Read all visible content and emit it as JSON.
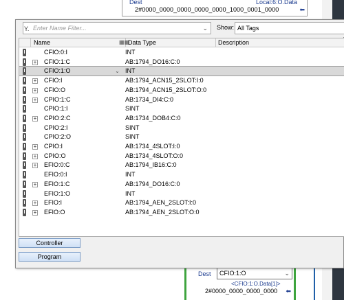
{
  "background": {
    "top_instruction": {
      "dest_label": "Dest",
      "dest_value": "Local:6:O.Data",
      "binary_value": "2#0000_0000_0000_0000_0000_1000_0001_0000"
    },
    "bottom_instruction": {
      "dest_label": "Dest",
      "dest_select_value": "CFIO:1:O",
      "tag_text": "<CFIO:1:O.Data[1]>",
      "binary_value": "2#0000_0000_0000_0000"
    }
  },
  "filter": {
    "placeholder": "Enter Name Filter...",
    "show_label": "Show:",
    "show_value": "All Tags"
  },
  "columns": [
    "Name",
    "Data Type",
    "Description"
  ],
  "rows": [
    {
      "name": "CFIO:0:I",
      "type": "INT",
      "expandable": false,
      "selected": false
    },
    {
      "name": "CFIO:1:C",
      "type": "AB:1794_DO16:C:0",
      "expandable": true,
      "selected": false
    },
    {
      "name": "CFIO:1:O",
      "type": "INT",
      "expandable": false,
      "selected": true
    },
    {
      "name": "CFIO:I",
      "type": "AB:1794_ACN15_2SLOT:I:0",
      "expandable": true,
      "selected": false
    },
    {
      "name": "CFIO:O",
      "type": "AB:1794_ACN15_2SLOT:O:0",
      "expandable": true,
      "selected": false
    },
    {
      "name": "CPIO:1:C",
      "type": "AB:1734_DI4:C:0",
      "expandable": true,
      "selected": false
    },
    {
      "name": "CPIO:1:I",
      "type": "SINT",
      "expandable": false,
      "selected": false
    },
    {
      "name": "CPIO:2:C",
      "type": "AB:1734_DOB4:C:0",
      "expandable": true,
      "selected": false
    },
    {
      "name": "CPIO:2:I",
      "type": "SINT",
      "expandable": false,
      "selected": false
    },
    {
      "name": "CPIO:2:O",
      "type": "SINT",
      "expandable": false,
      "selected": false
    },
    {
      "name": "CPIO:I",
      "type": "AB:1734_4SLOT:I:0",
      "expandable": true,
      "selected": false
    },
    {
      "name": "CPIO:O",
      "type": "AB:1734_4SLOT:O:0",
      "expandable": true,
      "selected": false
    },
    {
      "name": "EFIO:0:C",
      "type": "AB:1794_IB16:C:0",
      "expandable": true,
      "selected": false
    },
    {
      "name": "EFIO:0:I",
      "type": "INT",
      "expandable": false,
      "selected": false
    },
    {
      "name": "EFIO:1:C",
      "type": "AB:1794_DO16:C:0",
      "expandable": true,
      "selected": false
    },
    {
      "name": "EFIO:1:O",
      "type": "INT",
      "expandable": false,
      "selected": false
    },
    {
      "name": "EFIO:I",
      "type": "AB:1794_AEN_2SLOT:I:0",
      "expandable": true,
      "selected": false
    },
    {
      "name": "EFIO:O",
      "type": "AB:1794_AEN_2SLOT:O:0",
      "expandable": true,
      "selected": false
    }
  ],
  "scope_buttons": {
    "controller": "Controller",
    "program": "Program"
  },
  "icons": {
    "filter": "funnel-icon",
    "tag": "tag-icon",
    "expand": "plus-box-icon",
    "dropdown": "chevron-down-icon",
    "sort": "column-sort-icon",
    "arrow": "left-arrow-icon"
  }
}
